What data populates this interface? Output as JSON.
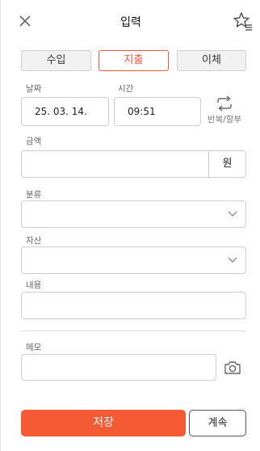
{
  "header": {
    "title": "입력",
    "close_icon": "close-icon",
    "favorite_icon": "star-list-icon"
  },
  "tabs": [
    {
      "label": "수입",
      "active": false
    },
    {
      "label": "지출",
      "active": true
    },
    {
      "label": "이체",
      "active": false
    }
  ],
  "accent_color": "#ee5a3d",
  "form": {
    "date": {
      "label": "날짜",
      "value": "25. 03. 14."
    },
    "time": {
      "label": "시간",
      "value": "09:51"
    },
    "repeat": {
      "label": "반복/할부",
      "icon": "repeat-icon"
    },
    "amount": {
      "label": "금액",
      "value": "",
      "unit": "원"
    },
    "category": {
      "label": "분류",
      "value": ""
    },
    "asset": {
      "label": "자산",
      "value": ""
    },
    "content": {
      "label": "내용",
      "value": ""
    },
    "memo": {
      "label": "메모",
      "value": "",
      "camera_icon": "camera-icon"
    }
  },
  "actions": {
    "save_label": "저장",
    "continue_label": "계속"
  }
}
